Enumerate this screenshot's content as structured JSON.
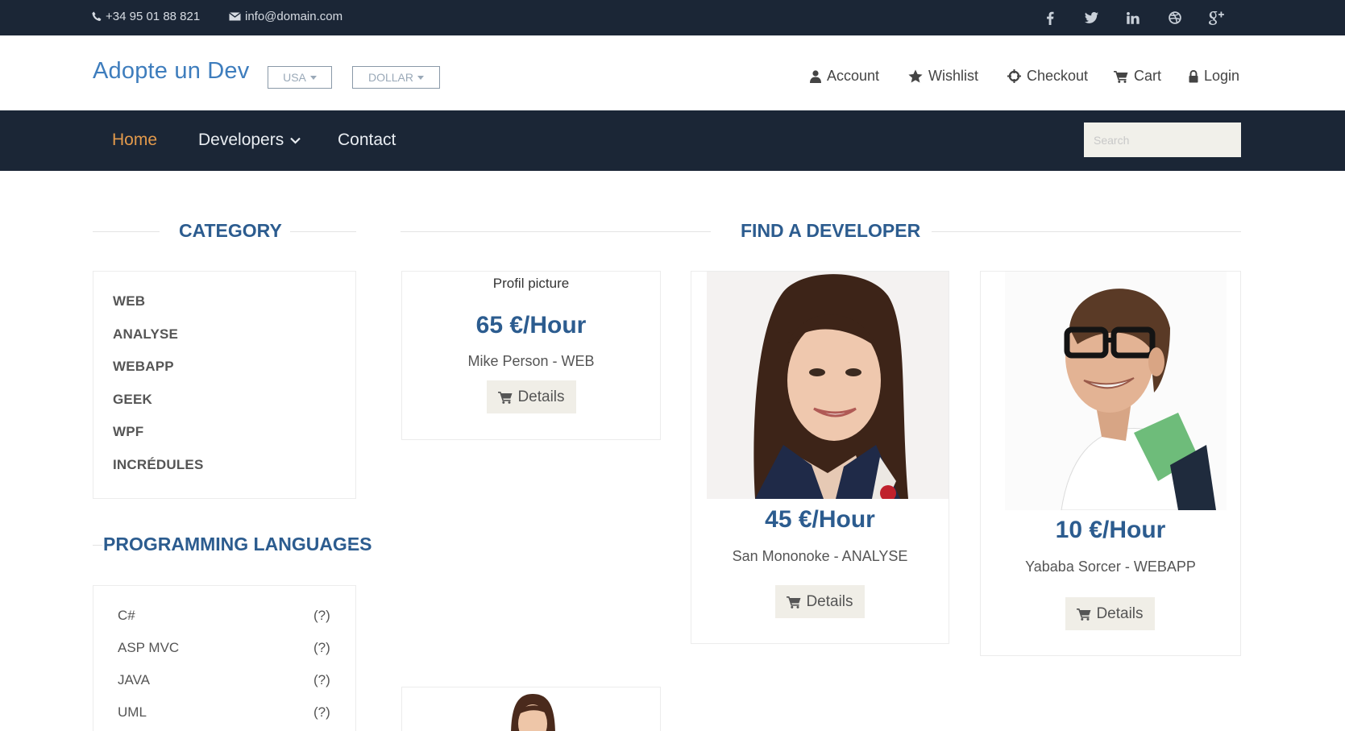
{
  "topbar": {
    "phone": "+34 95 01 88 821",
    "email": "info@domain.com",
    "social": [
      "facebook-icon",
      "twitter-icon",
      "linkedin-icon",
      "dribbble-icon",
      "google-plus-icon"
    ]
  },
  "header": {
    "logo": "Adopte un Dev",
    "country_select": "USA",
    "currency_select": "DOLLAR",
    "links": {
      "account": "Account",
      "wishlist": "Wishlist",
      "checkout": "Checkout",
      "cart": "Cart",
      "login": "Login"
    }
  },
  "nav": {
    "home": "Home",
    "developers": "Developers",
    "contact": "Contact",
    "search_placeholder": "Search"
  },
  "sidebar": {
    "category_title": "CATEGORY",
    "categories": [
      "WEB",
      "ANALYSE",
      "WEBAPP",
      "GEEK",
      "WPF",
      "INCRÉDULES"
    ],
    "languages_title": "PROGRAMMING LANGUAGES",
    "languages": [
      {
        "name": "C#",
        "count": "(?)"
      },
      {
        "name": "ASP MVC",
        "count": "(?)"
      },
      {
        "name": "JAVA",
        "count": "(?)"
      },
      {
        "name": "UML",
        "count": "(?)"
      }
    ]
  },
  "main": {
    "title": "FIND A DEVELOPER",
    "developers": [
      {
        "image_alt": "Profil picture",
        "price": "65 €/Hour",
        "name": "Mike Person - WEB",
        "button": "Details"
      },
      {
        "price": "45 €/Hour",
        "name": "San Mononoke - ANALYSE",
        "button": "Details"
      },
      {
        "price": "10 €/Hour",
        "name": "Yababa Sorcer - WEBAPP",
        "button": "Details"
      }
    ]
  },
  "colors": {
    "dark": "#1b2636",
    "accent": "#e39a4c",
    "heading": "#2c5c8f",
    "logo": "#3e7dbd"
  }
}
